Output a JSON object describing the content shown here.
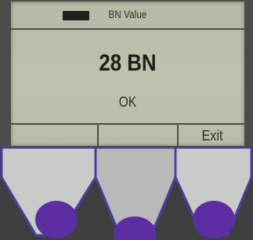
{
  "screen": {
    "title": "BN Value",
    "value": "28 BN",
    "status": "OK"
  },
  "softkeys": {
    "left": "",
    "middle": "",
    "right": "Exit"
  },
  "colors": {
    "lcd_background": "#b8bea9",
    "lcd_text": "#1c1f19",
    "button_face": "#c9cbc9",
    "button_pressed": "#b9bab8",
    "button_outline": "#4a3fa0",
    "button_dot": "#5a2ea2"
  },
  "icons": {
    "battery": "battery-icon"
  }
}
